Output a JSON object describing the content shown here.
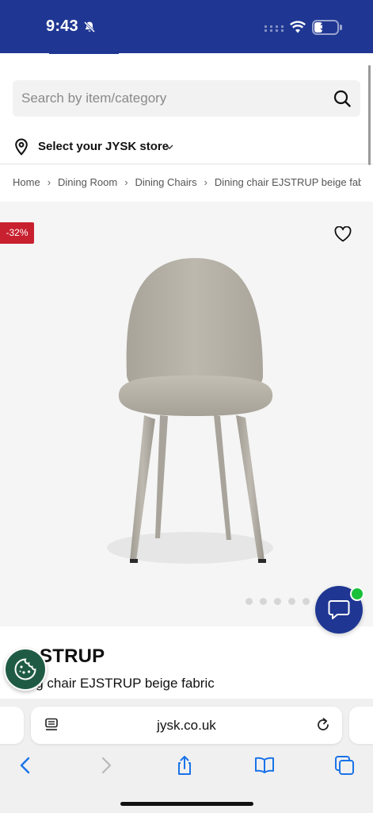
{
  "status_bar": {
    "time": "9:43",
    "battery": "35",
    "battery_level": 0.35
  },
  "search": {
    "placeholder": "Search by item/category"
  },
  "store": {
    "label": "Select your JYSK store"
  },
  "breadcrumb": {
    "items": [
      "Home",
      "Dining Room",
      "Dining Chairs",
      "Dining chair EJSTRUP beige fabric"
    ],
    "separator": "›"
  },
  "product": {
    "discount": "-32%",
    "name": "EJSTRUP",
    "name_visible": "STRUP",
    "subtitle": "Dining chair EJSTRUP beige fabric",
    "subtitle_visible": "ing chair EJSTRUP beige fabric",
    "image_count": 5
  },
  "browser": {
    "url": "jysk.co.uk"
  },
  "colors": {
    "brand_blue": "#1f3793",
    "discount_red": "#c8202f",
    "online_green": "#19c13a",
    "cookie_green": "#1f5b44",
    "safari_blue": "#1a73e8"
  }
}
